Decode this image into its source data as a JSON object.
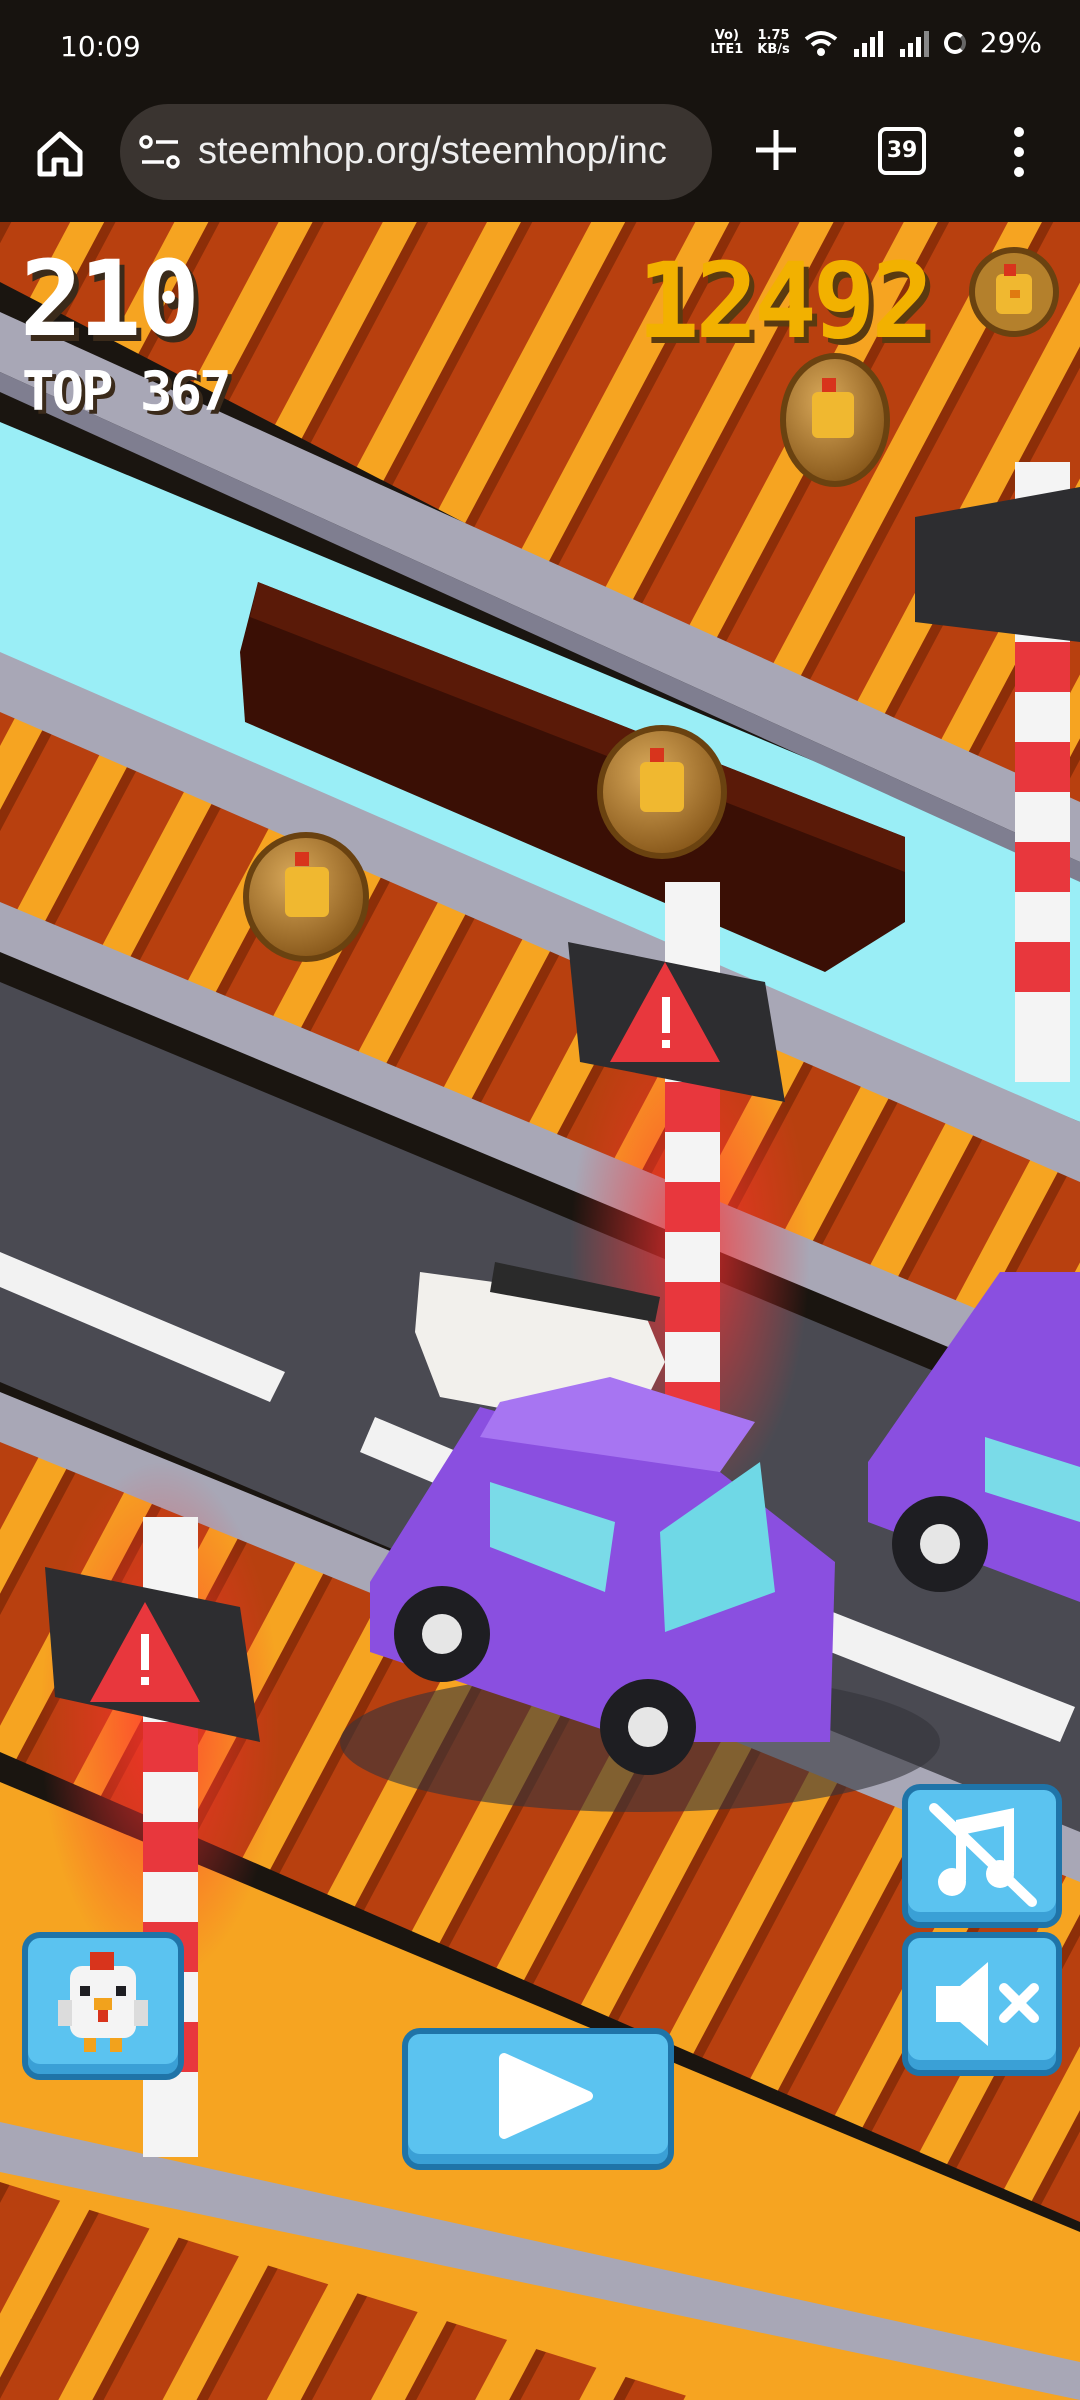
{
  "status_bar": {
    "time": "10:09",
    "network_small_1": "Vo)",
    "network_small_2": "LTE1",
    "speed_value": "1.75",
    "speed_unit": "KB/s",
    "battery": "29%"
  },
  "browser": {
    "url": "steemhop.org/steemhop/inc",
    "tab_count": "39",
    "icons": [
      "home-icon",
      "site-settings-icon",
      "plus-icon",
      "tabs-icon",
      "more-vert-icon"
    ]
  },
  "hud": {
    "score": "210",
    "top_score": "TOP 367",
    "coins": "12492"
  },
  "controls": {
    "icons": [
      "chicken-character-icon",
      "play-icon",
      "music-off-icon",
      "sound-off-icon"
    ]
  },
  "colors": {
    "sky_water": "#9aeef6",
    "rail_orange": "#f6a421",
    "road": "#4a4a52",
    "car_purple": "#8a4fe0",
    "button_blue": "#5bc3f0",
    "coin_gold": "#f2b100",
    "warning_red": "#e8373d"
  }
}
